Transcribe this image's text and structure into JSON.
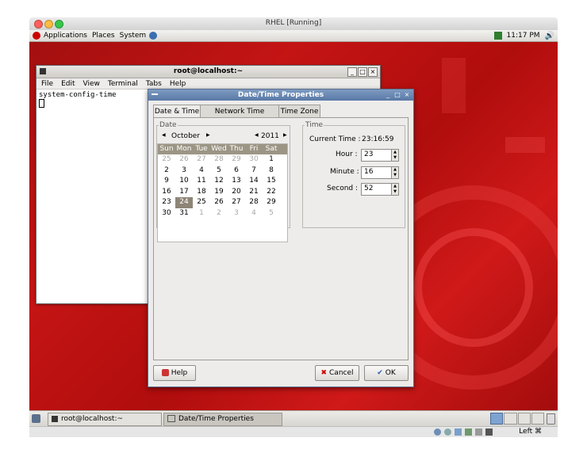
{
  "host_window": {
    "title": "RHEL [Running]"
  },
  "top_panel": {
    "menus": [
      "Applications",
      "Places",
      "System"
    ],
    "clock": "11:17 PM"
  },
  "terminal": {
    "title": "root@localhost:~",
    "menu": [
      "File",
      "Edit",
      "View",
      "Terminal",
      "Tabs",
      "Help"
    ],
    "command": "system-config-time"
  },
  "dialog": {
    "title": "Date/Time Properties",
    "tabs": [
      "Date & Time",
      "Network Time Protocol",
      "Time Zone"
    ],
    "date_frame_label": "Date",
    "month": "October",
    "year": "2011",
    "weekdays": [
      "Sun",
      "Mon",
      "Tue",
      "Wed",
      "Thu",
      "Fri",
      "Sat"
    ],
    "calendar_rows": [
      [
        "25",
        "26",
        "27",
        "28",
        "29",
        "30",
        "1"
      ],
      [
        "2",
        "3",
        "4",
        "5",
        "6",
        "7",
        "8"
      ],
      [
        "9",
        "10",
        "11",
        "12",
        "13",
        "14",
        "15"
      ],
      [
        "16",
        "17",
        "18",
        "19",
        "20",
        "21",
        "22"
      ],
      [
        "23",
        "24",
        "25",
        "26",
        "27",
        "28",
        "29"
      ],
      [
        "30",
        "31",
        "1",
        "2",
        "3",
        "4",
        "5"
      ]
    ],
    "selected_day": "24",
    "time_frame_label": "Time",
    "current_time_label": "Current Time :",
    "current_time_value": "23:16:59",
    "hour_label": "Hour :",
    "hour_value": "23",
    "minute_label": "Minute :",
    "minute_value": "16",
    "second_label": "Second :",
    "second_value": "52",
    "help_label": "Help",
    "cancel_label": "Cancel",
    "ok_label": "OK"
  },
  "taskbar": {
    "items": [
      "root@localhost:~",
      "Date/Time Properties"
    ]
  },
  "vbox_status": {
    "host_key": "Left ⌘"
  }
}
